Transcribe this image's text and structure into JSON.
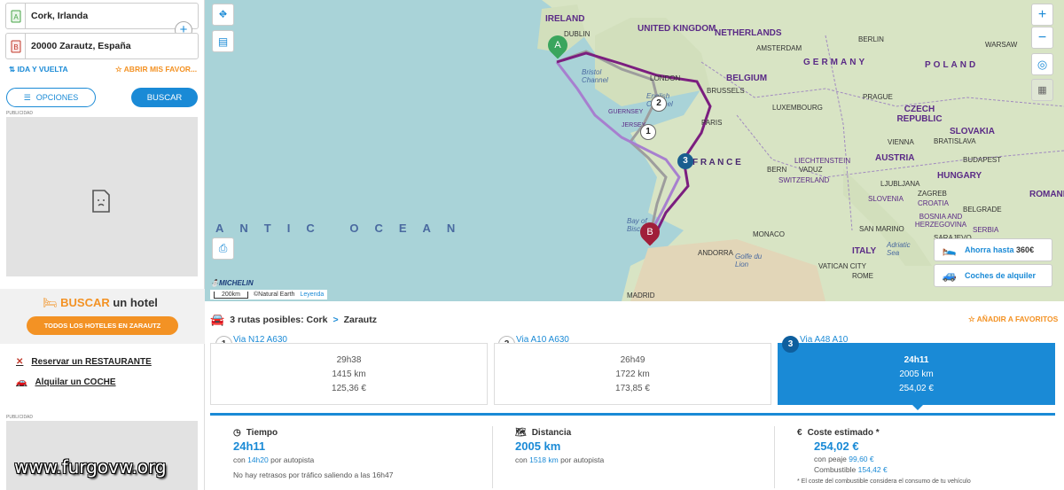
{
  "search": {
    "origin": "Cork, Irlanda",
    "destination": "20000 Zarautz, España",
    "add_label": "+",
    "round_trip": "IDA Y VUELTA",
    "favorites": "ABRIR MIS FAVOR...",
    "options_button": "OPCIONES",
    "search_button": "BUSCAR"
  },
  "ads": {
    "label": "PUBLICIDAD"
  },
  "hotel": {
    "title_highlight": "BUSCAR",
    "title_rest": " un hotel",
    "button": "TODOS LOS HOTELES EN ZARAUTZ"
  },
  "links": {
    "restaurant": "Reservar un RESTAURANTE",
    "car": "Alquilar un COCHE"
  },
  "watermark": "www.furgovw.org",
  "map": {
    "sea": "ANTIC OCEAN",
    "countries": {
      "ireland": "IRELAND",
      "uk": "UNITED KINGDOM",
      "netherlands": "NETHERLANDS",
      "germany": "GERMANY",
      "poland": "POLAND",
      "belgium": "BELGIUM",
      "luxembourg": "LUXEMBOURG",
      "czech": "CZECH REPUBLIC",
      "slovakia": "SLOVAKIA",
      "austria": "AUSTRIA",
      "hungary": "HUNGARY",
      "romania": "ROMANIA",
      "france": "F R A N C E",
      "italy": "ITALY",
      "liechtenstein": "LIECHTENSTEIN",
      "switzerland": "SWITZERLAND",
      "slovenia": "SLOVENIA",
      "croatia": "CROATIA",
      "bosnia": "BOSNIA AND HERZEGOVINA",
      "serbia": "SERBIA",
      "andorra": "ANDORRA",
      "monaco": "MONACO",
      "sanmarino": "SAN MARINO",
      "vatican": "VATICAN CITY"
    },
    "cities": {
      "dublin": "DUBLIN",
      "london": "LONDON",
      "amsterdam": "AMSTERDAM",
      "berlin": "BERLIN",
      "warsaw": "WARSAW",
      "brussels": "BRUSSELS",
      "prague": "PRAGUE",
      "paris": "PARIS",
      "vienna": "VIENNA",
      "bratislava": "BRATISLAVA",
      "budapest": "BUDAPEST",
      "bern": "BERN",
      "vaduz": "VADUZ",
      "ljubljana": "LJUBLJANA",
      "zagreb": "ZAGREB",
      "belgrade": "BELGRADE",
      "sarajevo": "SARAJEVO",
      "rome": "ROME",
      "madrid": "MADRID"
    },
    "waters": {
      "bristol": "Bristol Channel",
      "english": "English Channel",
      "biscay": "Bay of Biscay",
      "lion": "Golfe du Lion",
      "adriatic": "Adriatic Sea"
    },
    "islands": {
      "guernsey": "GUERNSEY",
      "jersey": "JERSEY"
    },
    "markers": {
      "start": "A",
      "end": "B",
      "r1": "1",
      "r2": "2",
      "r3": "3"
    },
    "scale": "200km",
    "credit": "©Natural Earth",
    "legend": "Leyenda",
    "brand": "MICHELIN",
    "zoom_in": "+",
    "zoom_out": "−",
    "promo_save": "Ahorra hasta",
    "promo_save_amount": "360€",
    "promo_rental": "Coches de alquiler",
    "route_colors": {
      "r1": "#9d9d9d",
      "r2": "#a77fcf",
      "r3": "#7b1e7f"
    }
  },
  "results": {
    "title_count": "3 rutas posibles: Cork",
    "title_arrow": ">",
    "title_dest": "Zarautz",
    "add_favorites": "AÑADIR A FAVORITOS",
    "routes": [
      {
        "num": "1",
        "via": "Via N12 A630",
        "time": "29h38",
        "distance": "1415 km",
        "cost": "125,36 €"
      },
      {
        "num": "2",
        "via": "Via A10 A630",
        "time": "26h49",
        "distance": "1722 km",
        "cost": "173,85 €"
      },
      {
        "num": "3",
        "via": "Via A48 A10",
        "time": "24h11",
        "distance": "2005 km",
        "cost": "254,02 €"
      }
    ],
    "summary": {
      "time_label": "Tiempo",
      "time_value": "24h11",
      "time_motorway_pre": "con",
      "time_motorway_val": "14h20",
      "time_motorway_post": "por autopista",
      "traffic": "No hay retrasos por tráfico saliendo a las 16h47",
      "distance_label": "Distancia",
      "distance_value": "2005 km",
      "distance_motorway_pre": "con",
      "distance_motorway_val": "1518 km",
      "distance_motorway_post": "por autopista",
      "cost_label": "Coste estimado *",
      "cost_value": "254,02 €",
      "toll_label": "con peaje",
      "toll_value": "99,60 €",
      "fuel_label": "Combustible",
      "fuel_value": "154,42 €",
      "footnote": "* El coste del combustible considera el consumo de tu vehículo"
    }
  },
  "colors": {
    "accent": "#1a8ad6",
    "orange": "#f39224"
  }
}
